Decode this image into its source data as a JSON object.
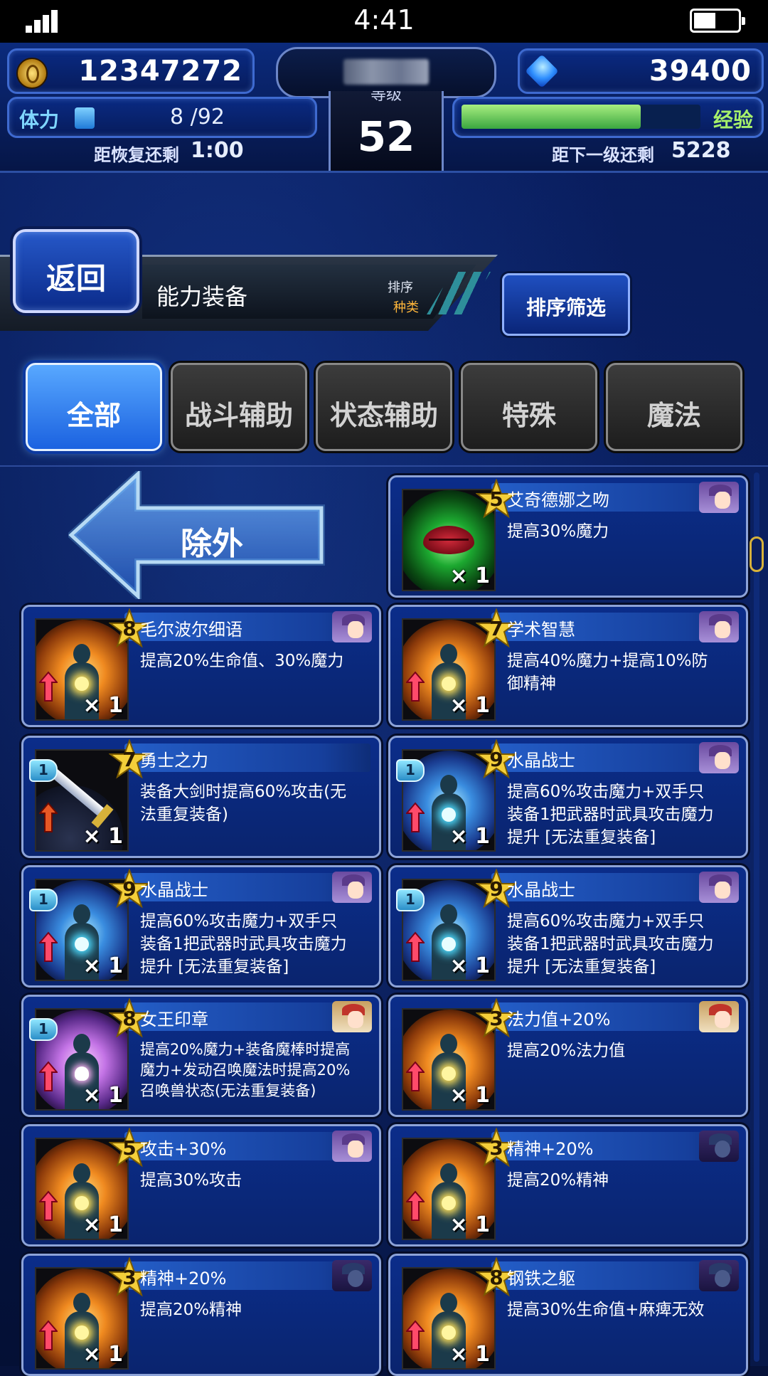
{
  "status_bar": {
    "time": "4:41"
  },
  "hud": {
    "gil": "12347272",
    "gems": "39400",
    "level_label": "等级",
    "level": "52",
    "stamina_label": "体力",
    "stamina_value": "8 /92",
    "stamina_fraction": 0.087,
    "recover_label": "距恢复还剩",
    "recover_time": "1:00",
    "exp_label": "经验",
    "exp_fraction": 0.75,
    "next_label": "距下一级还剩",
    "next_value": "5228"
  },
  "header": {
    "back_label": "返回",
    "title": "能力装备",
    "sort_label": "排序",
    "sort_value": "种类",
    "filter_label": "排序筛选"
  },
  "tabs": [
    {
      "label": "全部",
      "active": true
    },
    {
      "label": "战斗辅助",
      "active": false
    },
    {
      "label": "状态辅助",
      "active": false
    },
    {
      "label": "特殊",
      "active": false
    },
    {
      "label": "魔法",
      "active": false
    }
  ],
  "exclude_label": "除外",
  "cards": [
    {
      "name": "艾奇德娜之吻",
      "desc": "提高30%魔力",
      "stars": "5",
      "qty": "× 1",
      "icon": "lips-icon",
      "avatar": "purple"
    },
    {
      "name": "毛尔波尔细语",
      "desc": "提高20%生命值、30%魔力",
      "stars": "8",
      "qty": "× 1",
      "icon": "orange-figure-icon",
      "avatar": "purple"
    },
    {
      "name": "学术智慧",
      "desc": "提高40%魔力+提高10%防御精神",
      "stars": "7",
      "qty": "× 1",
      "icon": "orange-figure-icon",
      "avatar": "purple"
    },
    {
      "name": "勇士之力",
      "desc": "装备大剑时提高60%攻击(无法重复装备)",
      "stars": "7",
      "qty": "× 1",
      "badge": "1",
      "icon": "sword-icon",
      "avatar": "none"
    },
    {
      "name": "水晶战士",
      "desc": "提高60%攻击魔力+双手只装备1把武器时武具攻击魔力提升 [无法重复装备]",
      "stars": "9",
      "qty": "× 1",
      "badge": "1",
      "icon": "blue-figure-icon",
      "avatar": "purple"
    },
    {
      "name": "水晶战士",
      "desc": "提高60%攻击魔力+双手只装备1把武器时武具攻击魔力提升 [无法重复装备]",
      "stars": "9",
      "qty": "× 1",
      "badge": "1",
      "icon": "blue-figure-icon",
      "avatar": "purple"
    },
    {
      "name": "水晶战士",
      "desc": "提高60%攻击魔力+双手只装备1把武器时武具攻击魔力提升 [无法重复装备]",
      "stars": "9",
      "qty": "× 1",
      "badge": "1",
      "icon": "blue-figure-icon",
      "avatar": "purple"
    },
    {
      "name": "女王印章",
      "desc": "提高20%魔力+装备魔棒时提高魔力+发动召唤魔法时提高20%召唤兽状态(无法重复装备)",
      "stars": "8",
      "qty": "× 1",
      "badge": "1",
      "icon": "purple-figure-icon",
      "avatar": "red"
    },
    {
      "name": "法力值+20%",
      "desc": "提高20%法力值",
      "stars": "3",
      "qty": "× 1",
      "icon": "orange-figure-icon",
      "avatar": "red"
    },
    {
      "name": "攻击+30%",
      "desc": "提高30%攻击",
      "stars": "5",
      "qty": "× 1",
      "icon": "orange-figure-icon",
      "avatar": "purple"
    },
    {
      "name": "精神+20%",
      "desc": "提高20%精神",
      "stars": "3",
      "qty": "× 1",
      "icon": "orange-figure-icon",
      "avatar": "dark"
    },
    {
      "name": "精神+20%",
      "desc": "提高20%精神",
      "stars": "3",
      "qty": "× 1",
      "icon": "orange-figure-icon",
      "avatar": "dark"
    },
    {
      "name": "钢铁之躯",
      "desc": "提高30%生命值+麻痺无效",
      "stars": "8",
      "qty": "× 1",
      "icon": "orange-figure-icon",
      "avatar": "dark"
    }
  ]
}
